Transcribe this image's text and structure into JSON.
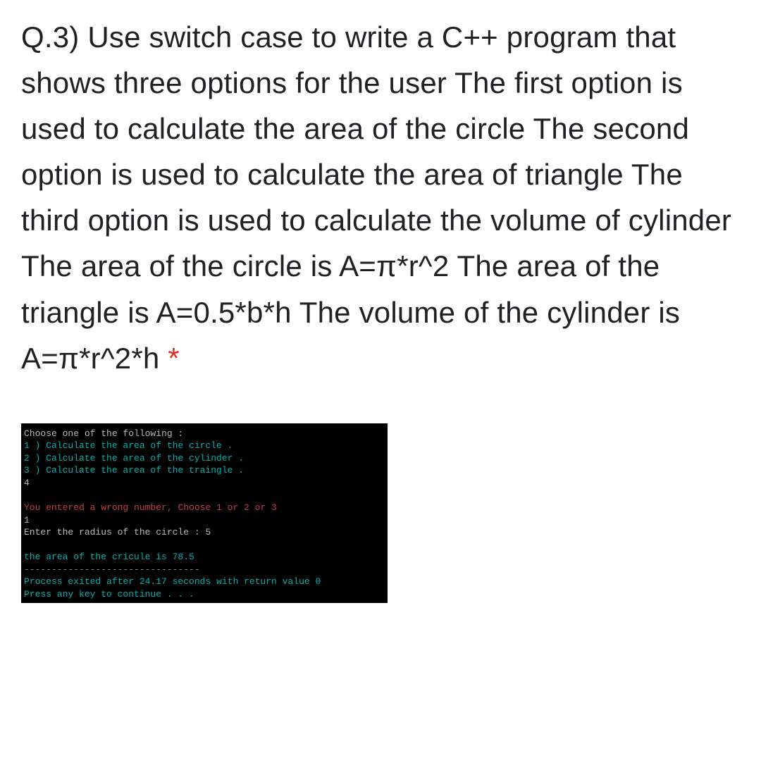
{
  "question": {
    "text": "Q.3) Use switch case to write a C++ program that shows three options for the user The first option is used to calculate the area of the circle The second option is used to calculate the area of triangle The third option is used to calculate the volume of cylinder The area of the circle is A=π*r^2 The area of the triangle is A=0.5*b*h The volume of the cylinder is A=π*r^2*h",
    "required_marker": " *"
  },
  "terminal": {
    "lines": [
      {
        "text": "Choose one of the following :",
        "class": "gray"
      },
      {
        "text": "1 ) Calculate the area of the circle .",
        "class": "cyan"
      },
      {
        "text": "2 ) Calculate the area of the cylinder .",
        "class": "cyan"
      },
      {
        "text": "3 ) Calculate the area of the traingle .",
        "class": "cyan"
      },
      {
        "text": "4",
        "class": "gray"
      },
      {
        "text": " ",
        "class": "gray"
      },
      {
        "text": "You entered a wrong number, Choose 1 or 2 or 3",
        "class": "red"
      },
      {
        "text": "1",
        "class": "gray"
      },
      {
        "text": "Enter the radius of the circle : 5",
        "class": "gray"
      },
      {
        "text": " ",
        "class": "gray"
      },
      {
        "text": "the area of the cricule is 78.5",
        "class": "cyan"
      },
      {
        "text": "--------------------------------",
        "class": "dashes"
      },
      {
        "text": "Process exited after 24.17 seconds with return value 0",
        "class": "cyan"
      },
      {
        "text": "Press any key to continue . . .",
        "class": "cyan"
      }
    ]
  }
}
